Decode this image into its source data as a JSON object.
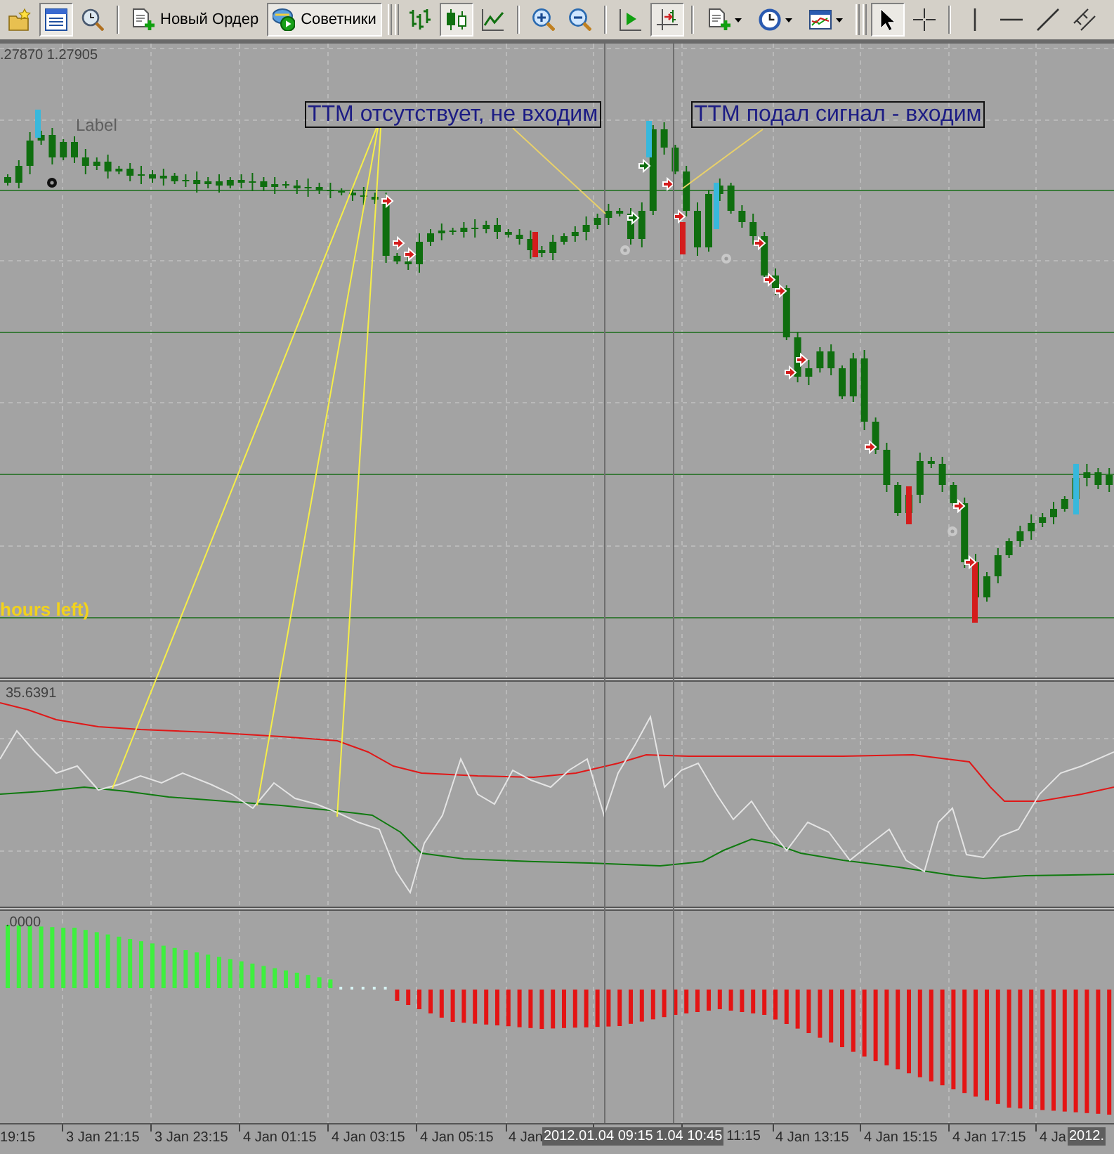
{
  "toolbars": [
    {
      "groups": [
        [
          {
            "kind": "icon",
            "pressed": false
          },
          {
            "kind": "icon",
            "pressed": true
          },
          {
            "kind": "icon",
            "pressed": false
          }
        ],
        [
          {
            "kind": "text",
            "label": "Новый Ордер",
            "pressed": false
          },
          {
            "kind": "text",
            "label": "Советники",
            "pressed": true
          }
        ]
      ]
    },
    {
      "groups": [
        [
          {
            "kind": "icon",
            "pressed": false
          },
          {
            "kind": "icon",
            "pressed": true
          },
          {
            "kind": "icon",
            "pressed": false
          }
        ],
        [
          {
            "kind": "icon",
            "pressed": false
          },
          {
            "kind": "icon",
            "pressed": false
          }
        ],
        [
          {
            "kind": "icon",
            "pressed": false
          },
          {
            "kind": "icon",
            "pressed": true
          }
        ],
        [
          {
            "kind": "menu",
            "pressed": false
          },
          {
            "kind": "menu",
            "pressed": false
          },
          {
            "kind": "menu",
            "pressed": false
          }
        ]
      ]
    },
    {
      "groups": [
        [
          {
            "kind": "icon",
            "pressed": true
          },
          {
            "kind": "icon",
            "pressed": false
          }
        ],
        [
          {
            "kind": "icon",
            "pressed": false
          },
          {
            "kind": "icon",
            "pressed": false
          },
          {
            "kind": "icon",
            "pressed": false
          },
          {
            "kind": "icon",
            "pressed": false
          }
        ]
      ]
    }
  ],
  "chart": {
    "price_header": ".27870 1.27905",
    "labels": [
      {
        "kind": "plain",
        "text": "Label"
      },
      {
        "kind": "boxed",
        "text": "ТТМ отсутствует, не входим"
      },
      {
        "kind": "boxed",
        "text": "ТТМ подал сигнал - входим"
      },
      {
        "kind": "alert",
        "text": "hours left)"
      }
    ]
  },
  "indicator_panels": [
    {
      "value": "35.6391"
    },
    {
      "value": ".0000"
    }
  ],
  "time_axis": {
    "labels": [
      "19:15",
      "3 Jan 21:15",
      "3 Jan 23:15",
      "4 Jan 01:15",
      "4 Jan 03:15",
      "4 Jan 05:15",
      "4 Jan",
      "11:15",
      "4 Jan 13:15",
      "4 Jan 15:15",
      "4 Jan 17:15",
      "4 Ja"
    ],
    "markers": [
      "2012.01.04 09:15",
      "1.04 10:45",
      "2012."
    ]
  }
}
